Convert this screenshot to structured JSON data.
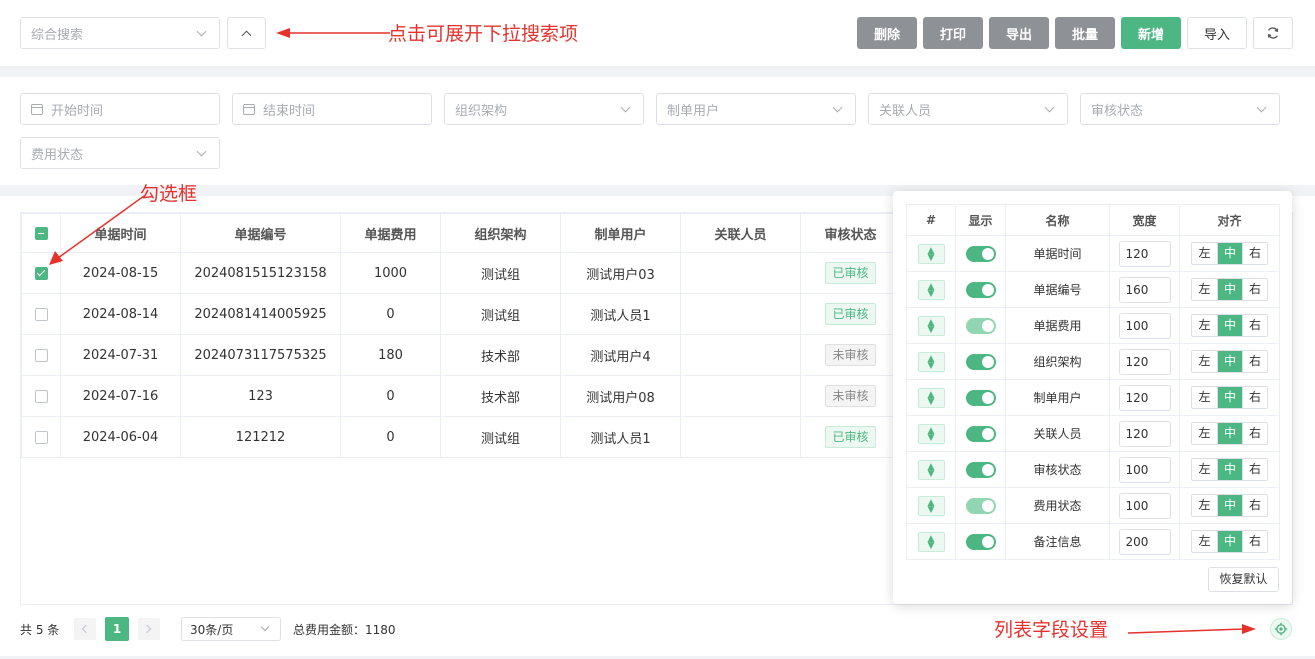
{
  "toolbar": {
    "search_placeholder": "综合搜索",
    "buttons": {
      "delete": "删除",
      "print": "打印",
      "export": "导出",
      "batch": "批量",
      "add": "新增",
      "import": "导入"
    }
  },
  "annotations": {
    "expand": "点击可展开下拉搜索项",
    "checkbox": "勾选框",
    "settings": "列表字段设置"
  },
  "filters": {
    "start_time": "开始时间",
    "end_time": "结束时间",
    "org": "组织架构",
    "creator": "制单用户",
    "related": "关联人员",
    "audit": "审核状态",
    "fee_status": "费用状态"
  },
  "table": {
    "headers": [
      "单据时间",
      "单据编号",
      "单据费用",
      "组织架构",
      "制单用户",
      "关联人员",
      "审核状态"
    ],
    "rows": [
      {
        "date": "2024-08-15",
        "no": "2024081515123158",
        "fee": "1000",
        "org": "测试组",
        "user": "测试用户03",
        "related": "",
        "status": "已审核",
        "checked": true
      },
      {
        "date": "2024-08-14",
        "no": "2024081414005925",
        "fee": "0",
        "org": "测试组",
        "user": "测试人员1",
        "related": "",
        "status": "已审核",
        "checked": false
      },
      {
        "date": "2024-07-31",
        "no": "2024073117575325",
        "fee": "180",
        "org": "技术部",
        "user": "测试用户4",
        "related": "",
        "status": "未审核",
        "checked": false
      },
      {
        "date": "2024-07-16",
        "no": "123",
        "fee": "0",
        "org": "技术部",
        "user": "测试用户08",
        "related": "",
        "status": "未审核",
        "checked": false
      },
      {
        "date": "2024-06-04",
        "no": "121212",
        "fee": "0",
        "org": "测试组",
        "user": "测试人员1",
        "related": "",
        "status": "已审核",
        "checked": false
      }
    ]
  },
  "settings_panel": {
    "headers": [
      "#",
      "显示",
      "名称",
      "宽度",
      "对齐"
    ],
    "align_labels": [
      "左",
      "中",
      "右"
    ],
    "rows": [
      {
        "name": "单据时间",
        "width": "120",
        "visible": true
      },
      {
        "name": "单据编号",
        "width": "160",
        "visible": true
      },
      {
        "name": "单据费用",
        "width": "100",
        "visible": true,
        "disabled": true
      },
      {
        "name": "组织架构",
        "width": "120",
        "visible": true
      },
      {
        "name": "制单用户",
        "width": "120",
        "visible": true
      },
      {
        "name": "关联人员",
        "width": "120",
        "visible": true
      },
      {
        "name": "审核状态",
        "width": "100",
        "visible": true
      },
      {
        "name": "费用状态",
        "width": "100",
        "visible": true,
        "disabled": true
      },
      {
        "name": "备注信息",
        "width": "200",
        "visible": true
      }
    ],
    "reset_label": "恢复默认"
  },
  "pagination": {
    "total": "共 5 条",
    "current_page": "1",
    "page_size": "30条/页",
    "total_fee": "总费用金额：1180"
  },
  "colors": {
    "accent": "#4cb782",
    "gray_button": "#8e9196",
    "annotation": "#e5322d"
  }
}
